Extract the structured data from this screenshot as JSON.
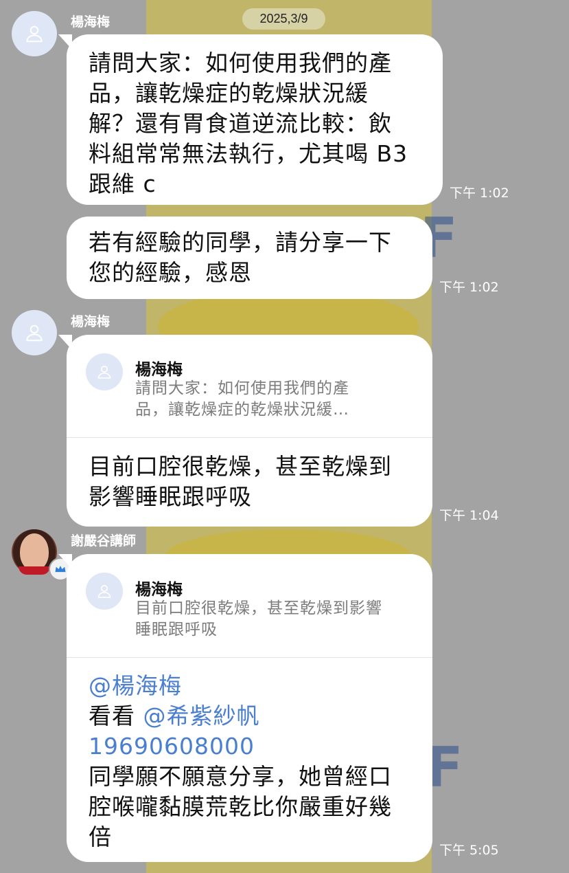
{
  "date_label": "2025,3/9",
  "messages": [
    {
      "sender": "楊海梅",
      "lines": [
        "請問大家：如何使用我們的產",
        "品，讓乾燥症的乾燥狀況緩",
        "解？還有胃食道逆流比較：飲",
        "料組常常無法執行，尤其喝 B3",
        "跟維 c"
      ],
      "time": "下午 1:02"
    },
    {
      "lines": [
        "若有經驗的同學，請分享一下",
        "您的經驗，感恩"
      ],
      "time": "下午 1:02"
    },
    {
      "sender": "楊海梅",
      "quote": {
        "name": "楊海梅",
        "lines": [
          "請問大家：如何使用我們的產",
          "品，讓乾燥症的乾燥狀況緩…"
        ]
      },
      "lines": [
        "目前口腔很乾燥，甚至乾燥到",
        "影響睡眠跟呼吸"
      ],
      "time": "下午 1:04"
    },
    {
      "sender": "謝嚴谷講師",
      "quote": {
        "name": "楊海梅",
        "lines": [
          "目前口腔很乾燥，甚至乾燥到影響",
          "睡眠跟呼吸"
        ]
      },
      "mention1": "@楊海梅",
      "line2_prefix": "看看 ",
      "mention2": "@希紫紗帆",
      "mention3": "19690608000",
      "lines": [
        "同學願不願意分享，她曾經口",
        "腔喉嚨黏膜荒乾比你嚴重好幾",
        "倍"
      ],
      "time": "下午 5:05"
    }
  ],
  "colors": {
    "background": "#a3a3a3",
    "bubble": "#ffffff",
    "mention": "#4a7fd0",
    "date_pill": "#d7d2a6"
  },
  "icons": [
    "user-avatar-icon",
    "crown-icon"
  ]
}
